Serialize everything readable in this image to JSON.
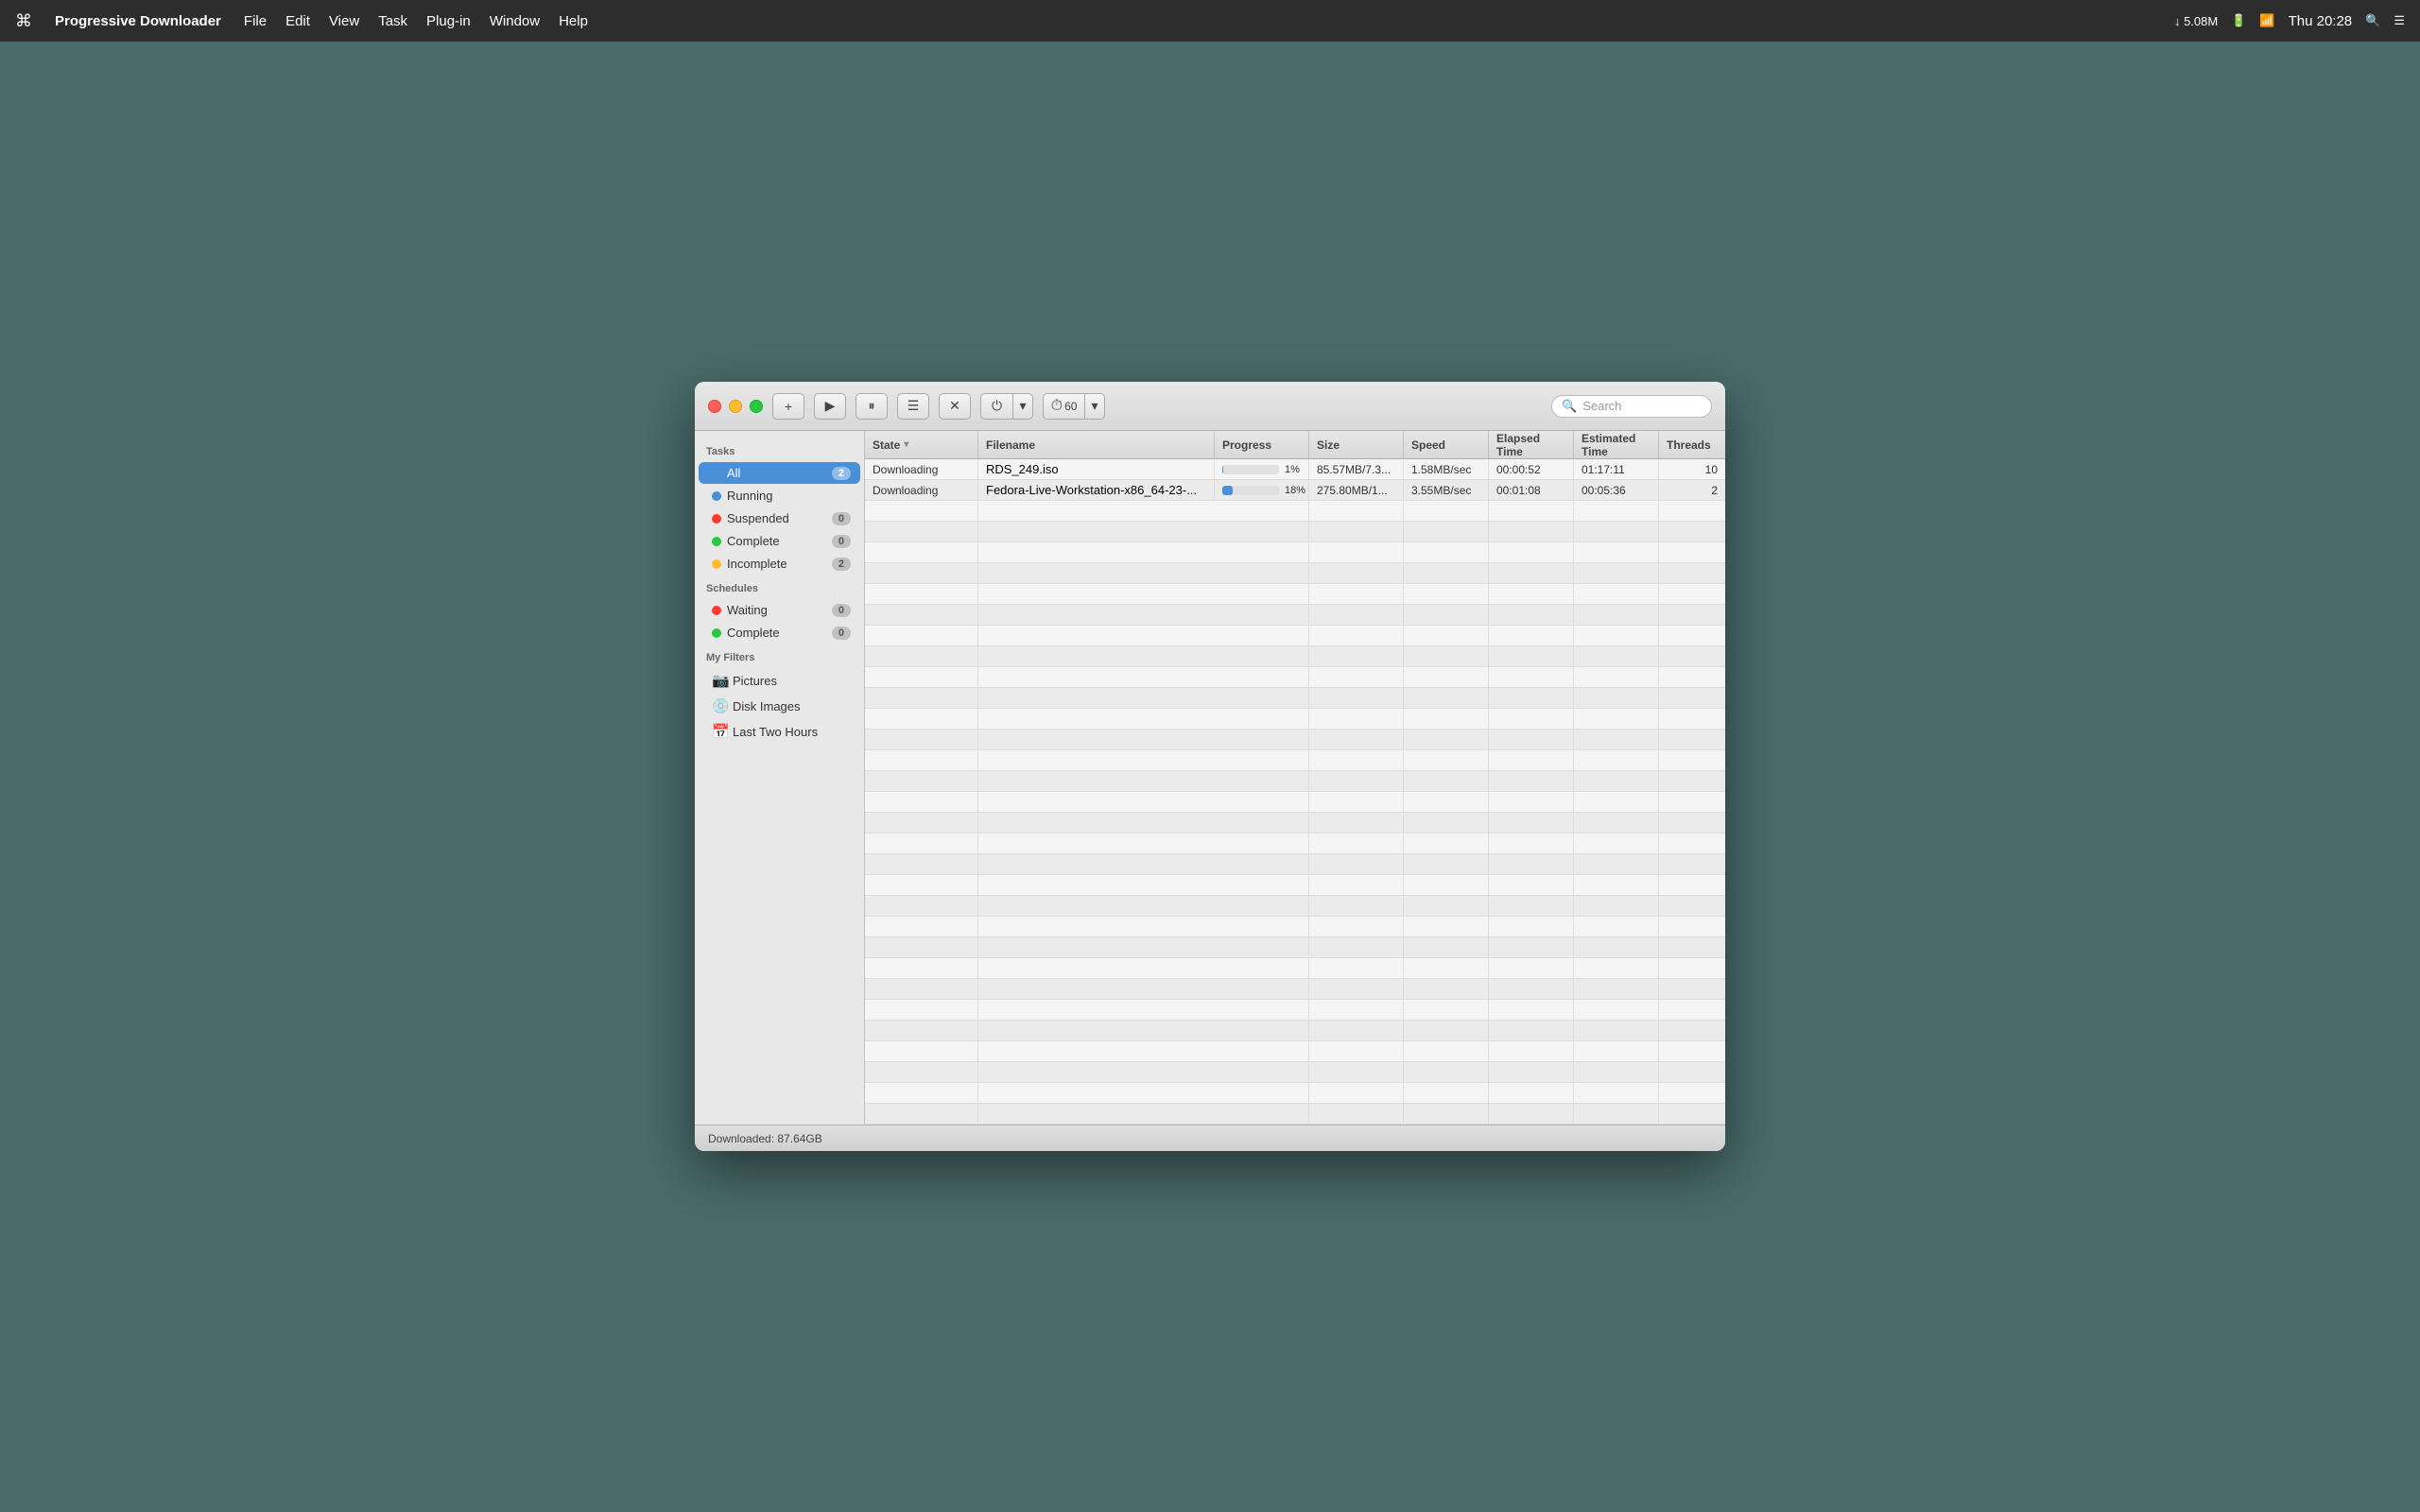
{
  "menubar": {
    "apple": "⌘",
    "app_name": "Progressive Downloader",
    "menu_items": [
      "File",
      "Edit",
      "View",
      "Task",
      "Plug-in",
      "Window",
      "Help"
    ],
    "right": {
      "download_icon": "↓",
      "speed": "5.08M",
      "time": "Thu 20:28"
    }
  },
  "toolbar": {
    "add_label": "+",
    "play_label": "▶",
    "pause_label": "⏸",
    "list_label": "☰",
    "close_label": "✕",
    "power_label": "⏻",
    "timer_label": "60",
    "search_placeholder": "Search"
  },
  "sidebar": {
    "tasks_section": "Tasks",
    "schedules_section": "Schedules",
    "my_filters_section": "My Filters",
    "items": [
      {
        "id": "all",
        "label": "All",
        "dot_color": "dot-blue",
        "badge": "2",
        "selected": true
      },
      {
        "id": "running",
        "label": "Running",
        "dot_color": "dot-blue",
        "badge": ""
      },
      {
        "id": "suspended",
        "label": "Suspended",
        "dot_color": "dot-red",
        "badge": "0"
      },
      {
        "id": "complete",
        "label": "Complete",
        "dot_color": "dot-green",
        "badge": "0"
      },
      {
        "id": "incomplete",
        "label": "Incomplete",
        "dot_color": "dot-yellow",
        "badge": "2"
      }
    ],
    "schedule_items": [
      {
        "id": "waiting",
        "label": "Waiting",
        "dot_color": "dot-red",
        "badge": "0"
      },
      {
        "id": "sched-complete",
        "label": "Complete",
        "dot_color": "dot-green",
        "badge": "0"
      }
    ],
    "filter_items": [
      {
        "id": "pictures",
        "label": "Pictures",
        "icon": "📷"
      },
      {
        "id": "disk-images",
        "label": "Disk Images",
        "icon": "💿"
      },
      {
        "id": "last-two-hours",
        "label": "Last Two Hours",
        "icon": "📅"
      }
    ]
  },
  "table": {
    "columns": [
      {
        "id": "state",
        "label": "State",
        "has_sort": true
      },
      {
        "id": "filename",
        "label": "Filename"
      },
      {
        "id": "progress",
        "label": "Progress"
      },
      {
        "id": "size",
        "label": "Size"
      },
      {
        "id": "speed",
        "label": "Speed"
      },
      {
        "id": "elapsed",
        "label": "Elapsed Time"
      },
      {
        "id": "estimated",
        "label": "Estimated Time"
      },
      {
        "id": "threads",
        "label": "Threads"
      }
    ],
    "rows": [
      {
        "state": "Downloading",
        "filename": "RDS_249.iso",
        "progress_pct": 1,
        "progress_text": "1%",
        "size": "85.57MB/7.3...",
        "speed": "1.58MB/sec",
        "elapsed": "00:00:52",
        "estimated": "01:17:11",
        "threads": "10"
      },
      {
        "state": "Downloading",
        "filename": "Fedora-Live-Workstation-x86_64-23-...",
        "progress_pct": 18,
        "progress_text": "18%",
        "size": "275.80MB/1...",
        "speed": "3.55MB/sec",
        "elapsed": "00:01:08",
        "estimated": "00:05:36",
        "threads": "2"
      }
    ],
    "empty_rows": 30
  },
  "statusbar": {
    "downloaded_label": "Downloaded:",
    "downloaded_value": "87.64GB",
    "text": "Downloaded: 87.64GB"
  }
}
